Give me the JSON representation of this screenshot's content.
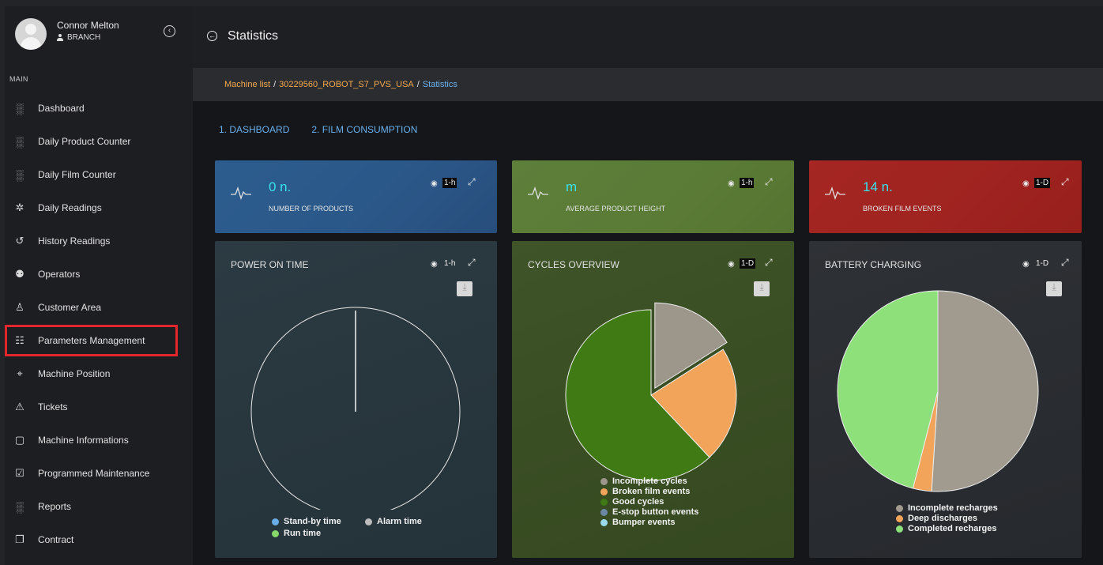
{
  "user": {
    "name": "Connor Melton",
    "role": "BRANCH"
  },
  "sidebar": {
    "section": "MAIN",
    "items": [
      {
        "label": "Dashboard",
        "icon": "chart-icon"
      },
      {
        "label": "Daily Product Counter",
        "icon": "chart-icon"
      },
      {
        "label": "Daily Film Counter",
        "icon": "chart-icon"
      },
      {
        "label": "Daily Readings",
        "icon": "readings-icon"
      },
      {
        "label": "History Readings",
        "icon": "history-icon"
      },
      {
        "label": "Operators",
        "icon": "users-icon"
      },
      {
        "label": "Customer Area",
        "icon": "person-icon"
      },
      {
        "label": "Parameters Management",
        "icon": "list-icon"
      },
      {
        "label": "Machine Position",
        "icon": "location-icon"
      },
      {
        "label": "Tickets",
        "icon": "warning-icon"
      },
      {
        "label": "Machine Informations",
        "icon": "clipboard-icon"
      },
      {
        "label": "Programmed Maintenance",
        "icon": "checklist-icon"
      },
      {
        "label": "Reports",
        "icon": "chart-icon"
      },
      {
        "label": "Contract",
        "icon": "contract-icon"
      }
    ]
  },
  "header": {
    "title": "Statistics"
  },
  "breadcrumb": {
    "items": [
      "Machine list",
      "30229560_ROBOT_S7_PVS_USA"
    ],
    "current": "Statistics",
    "separator": "/"
  },
  "tabs": [
    "1. DASHBOARD",
    "2. FILM CONSUMPTION"
  ],
  "stat_cards": [
    {
      "value": "0 n.",
      "label": "NUMBER OF PRODUCTS",
      "period": "1-h",
      "color": "#2b5a8a"
    },
    {
      "value": "m",
      "label": "AVERAGE PRODUCT HEIGHT",
      "period": "1-h",
      "color": "#5a7b36"
    },
    {
      "value": "14 n.",
      "label": "BROKEN FILM EVENTS",
      "period": "1-D",
      "color": "#a02420"
    }
  ],
  "chart_cards": [
    {
      "title": "POWER ON TIME",
      "period": "1-h"
    },
    {
      "title": "CYCLES OVERVIEW",
      "period": "1-D"
    },
    {
      "title": "BATTERY CHARGING",
      "period": "1-D"
    }
  ],
  "chart_data": [
    {
      "type": "pie",
      "title": "POWER ON TIME",
      "categories": [
        "Stand-by time",
        "Alarm time",
        "Run time"
      ],
      "values": [
        0,
        0,
        0
      ],
      "colors": [
        "#6aaee8",
        "#bdbdbd",
        "#86d86b"
      ]
    },
    {
      "type": "pie",
      "title": "CYCLES OVERVIEW",
      "categories": [
        "Incomplete cycles",
        "Broken film events",
        "Good cycles",
        "E-stop button events",
        "Bumper events"
      ],
      "values": [
        16,
        22,
        62,
        0,
        0
      ],
      "colors": [
        "#9c968b",
        "#f2a55a",
        "#3f7a14",
        "#6b87a5",
        "#9adbea"
      ]
    },
    {
      "type": "pie",
      "title": "BATTERY CHARGING",
      "categories": [
        "Incomplete recharges",
        "Deep discharges",
        "Completed recharges"
      ],
      "values": [
        51,
        3,
        46
      ],
      "colors": [
        "#a09a8f",
        "#f2a55a",
        "#8de07a"
      ]
    }
  ]
}
